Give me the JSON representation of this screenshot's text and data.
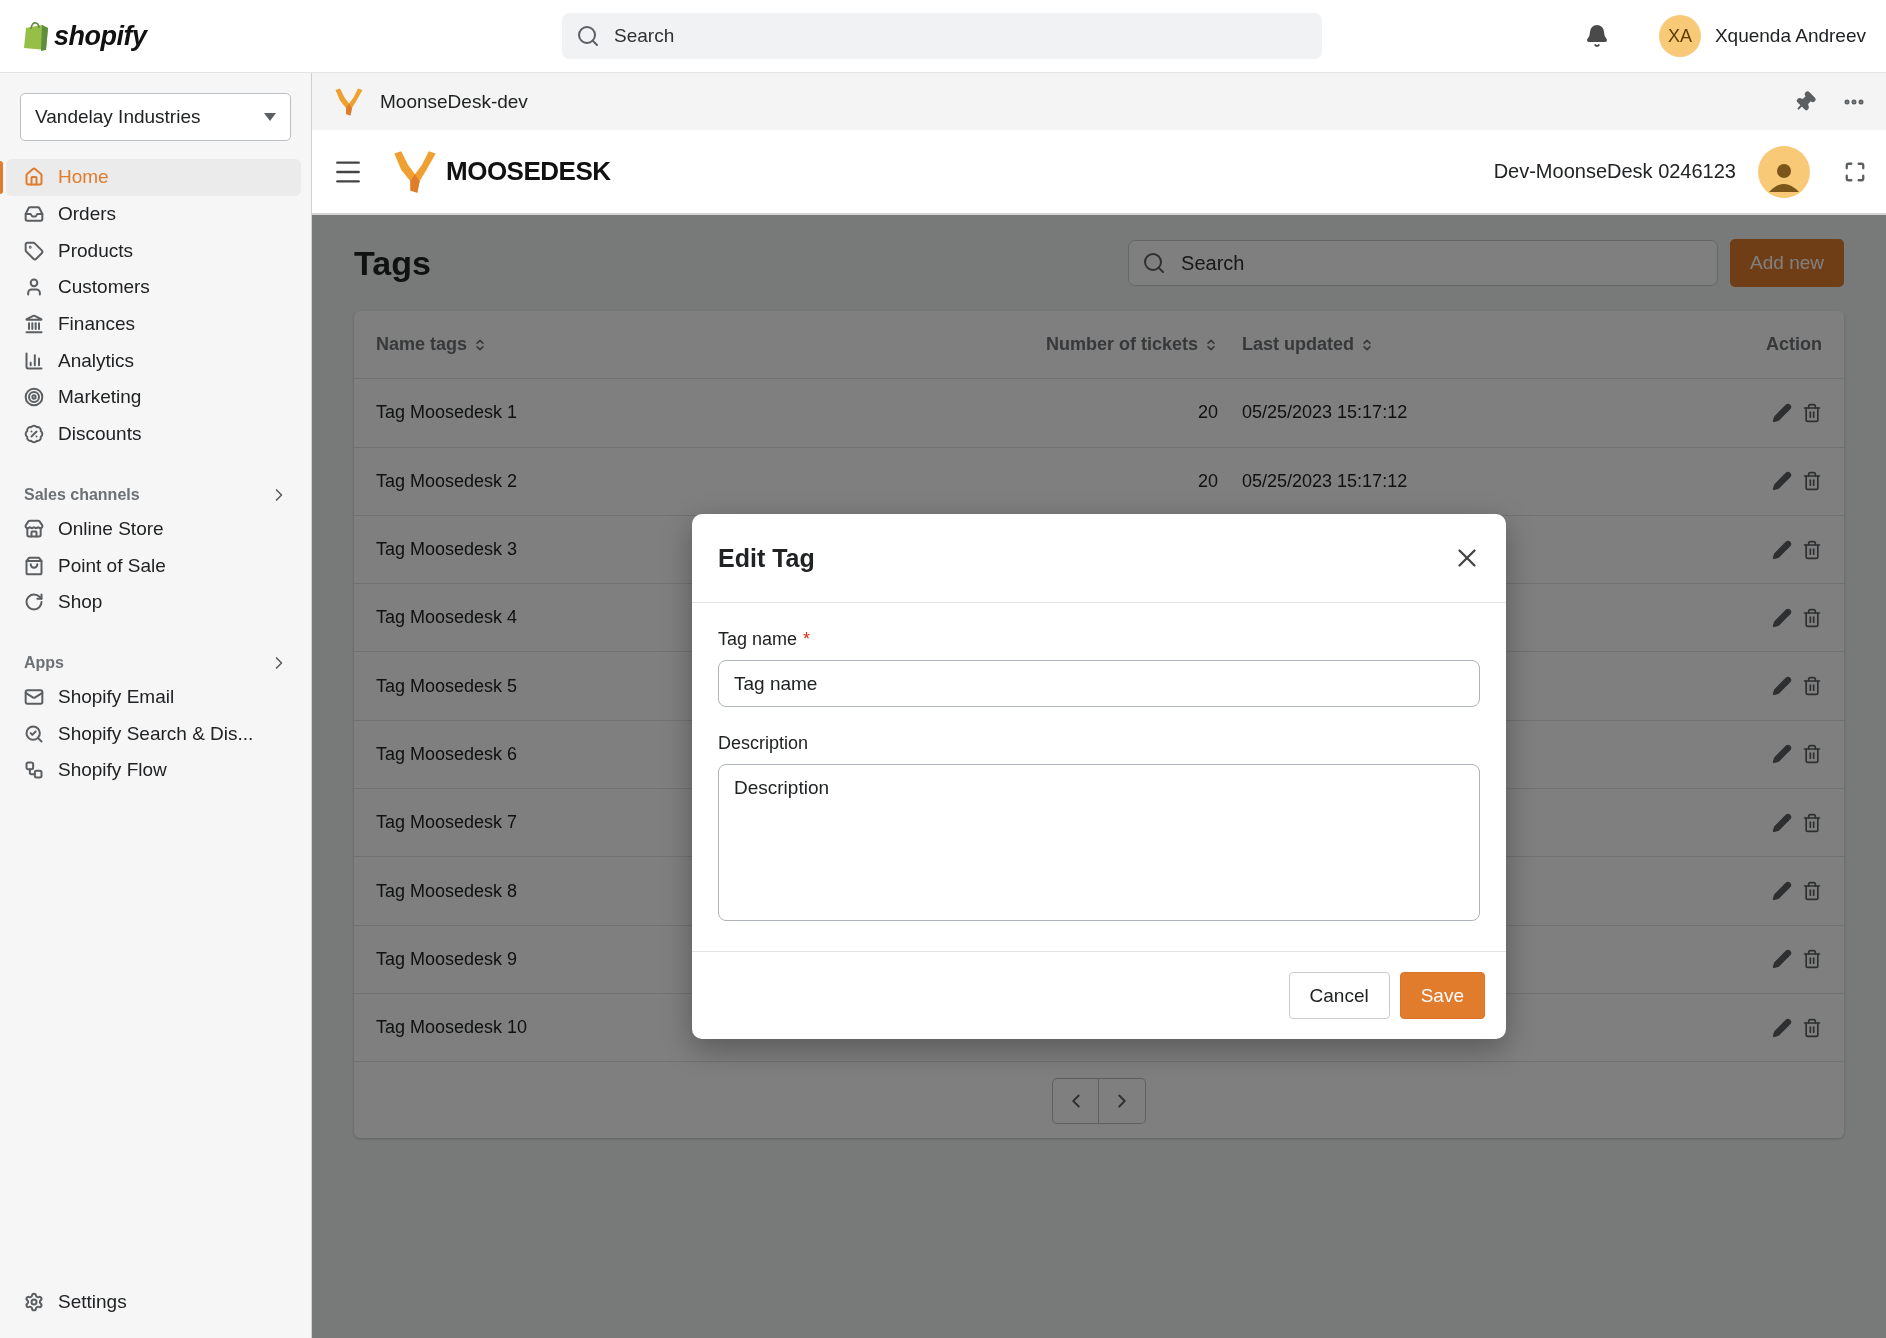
{
  "topbar": {
    "brand": "shopify",
    "search": {
      "placeholder": "Search"
    },
    "user": {
      "initials": "XA",
      "name": "Xquenda Andreev"
    }
  },
  "sidebar": {
    "store": "Vandelay Industries",
    "items": [
      {
        "label": "Home",
        "selected": true
      },
      {
        "label": "Orders",
        "selected": false
      },
      {
        "label": "Products",
        "selected": false
      },
      {
        "label": "Customers",
        "selected": false
      },
      {
        "label": "Finances",
        "selected": false
      },
      {
        "label": "Analytics",
        "selected": false
      },
      {
        "label": "Marketing",
        "selected": false
      },
      {
        "label": "Discounts",
        "selected": false
      }
    ],
    "sections": [
      {
        "title": "Sales channels",
        "items": [
          {
            "label": "Online Store",
            "selected": false
          },
          {
            "label": "Point of Sale",
            "selected": false
          },
          {
            "label": "Shop",
            "selected": false
          }
        ]
      },
      {
        "title": "Apps",
        "items": [
          {
            "label": "Shopify Email",
            "selected": false
          },
          {
            "label": "Shopify Search & Dis...",
            "selected": false
          },
          {
            "label": "Shopify Flow",
            "selected": false
          }
        ]
      }
    ],
    "settings": "Settings"
  },
  "app_bar": {
    "title": "MoonseDesk-dev"
  },
  "app_header": {
    "logo": "MOOSEDESK",
    "account": "Dev-MoonseDesk 0246123"
  },
  "page": {
    "title": "Tags",
    "search": {
      "placeholder": "Search"
    },
    "add_button": "Add new"
  },
  "table": {
    "columns": [
      {
        "label": "Name tags",
        "sortable": true
      },
      {
        "label": "Number of tickets",
        "sortable": true
      },
      {
        "label": "Last updated",
        "sortable": true
      },
      {
        "label": "Action",
        "sortable": false
      }
    ],
    "rows": [
      {
        "name": "Tag Moosedesk 1",
        "tickets": "20",
        "updated": "05/25/2023 15:17:12"
      },
      {
        "name": "Tag Moosedesk 2",
        "tickets": "20",
        "updated": "05/25/2023 15:17:12"
      },
      {
        "name": "Tag Moosedesk 3"
      },
      {
        "name": "Tag Moosedesk 4"
      },
      {
        "name": "Tag Moosedesk 5"
      },
      {
        "name": "Tag Moosedesk 6"
      },
      {
        "name": "Tag Moosedesk 7"
      },
      {
        "name": "Tag Moosedesk 8"
      },
      {
        "name": "Tag Moosedesk 9"
      },
      {
        "name": "Tag Moosedesk 10"
      }
    ]
  },
  "modal": {
    "title": "Edit Tag",
    "fields": [
      {
        "kind": "input",
        "label": "Tag name",
        "required_mark": "*",
        "placeholder": "Tag name"
      },
      {
        "kind": "textarea",
        "label": "Description",
        "placeholder": "Description"
      }
    ],
    "buttons": [
      {
        "label": "Cancel",
        "primary": false
      },
      {
        "label": "Save",
        "primary": true
      }
    ]
  }
}
